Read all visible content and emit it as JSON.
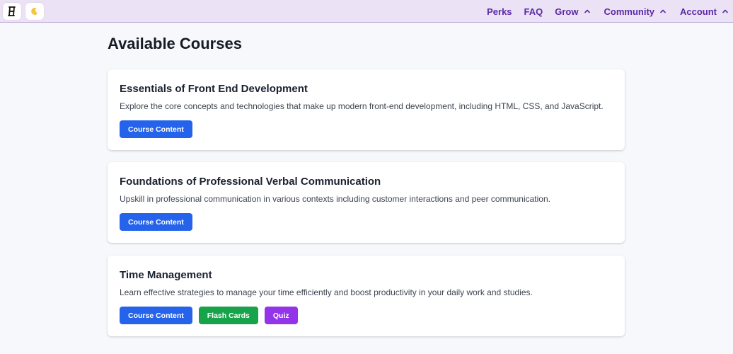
{
  "header": {
    "nav": [
      {
        "label": "Perks",
        "has_menu": false
      },
      {
        "label": "FAQ",
        "has_menu": false
      },
      {
        "label": "Grow",
        "has_menu": true
      },
      {
        "label": "Community",
        "has_menu": true
      },
      {
        "label": "Account",
        "has_menu": true
      }
    ],
    "logo_icon": "logo-icon",
    "theme_icon": "moon-icon"
  },
  "main": {
    "title": "Available Courses",
    "courses": [
      {
        "title": "Essentials of Front End Development",
        "description": "Explore the core concepts and technologies that make up modern front-end development, including HTML, CSS, and JavaScript.",
        "buttons": [
          "Course Content"
        ]
      },
      {
        "title": "Foundations of Professional Verbal Communication",
        "description": "Upskill in professional communication in various contexts including customer interactions and peer communication.",
        "buttons": [
          "Course Content"
        ]
      },
      {
        "title": "Time Management",
        "description": "Learn effective strategies to manage your time efficiently and boost productivity in your daily work and studies.",
        "buttons": [
          "Course Content",
          "Flash Cards",
          "Quiz"
        ]
      }
    ]
  },
  "colors": {
    "accent_nav": "#5b2aa6",
    "header_bg": "#ebe3f5",
    "button_blue": "#2563eb",
    "button_green": "#16a34a",
    "button_purple": "#9333ea"
  }
}
